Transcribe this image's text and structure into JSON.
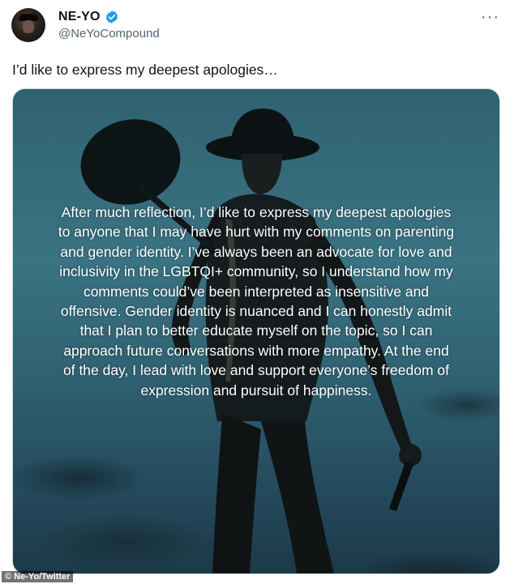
{
  "user": {
    "display_name": "NE-YO",
    "handle": "@NeYoCompound",
    "avatar_icon": "avatar-icon",
    "verified_icon": "verified-badge-icon",
    "verified_color": "#1d9bf0"
  },
  "more_label": "···",
  "tweet_text": "I’d like to express my deepest apologies…",
  "media": {
    "overlay_text": "After much reflection, I’d like to express my deepest apologies to anyone that I may have hurt with my comments on parenting and gender identity. I’ve always been an advocate for love and inclusivity in the LGBTQI+ community, so I understand how my comments could’ve been interpreted as insensitive and offensive. Gender identity is nuanced and I can honestly admit that I plan to better educate myself on the topic, so I can approach future conversations with more empathy. At the end of the day, I lead with love and support everyone’s freedom of expression and pursuit of happiness."
  },
  "credit": "© Ne-Yo/Twitter"
}
